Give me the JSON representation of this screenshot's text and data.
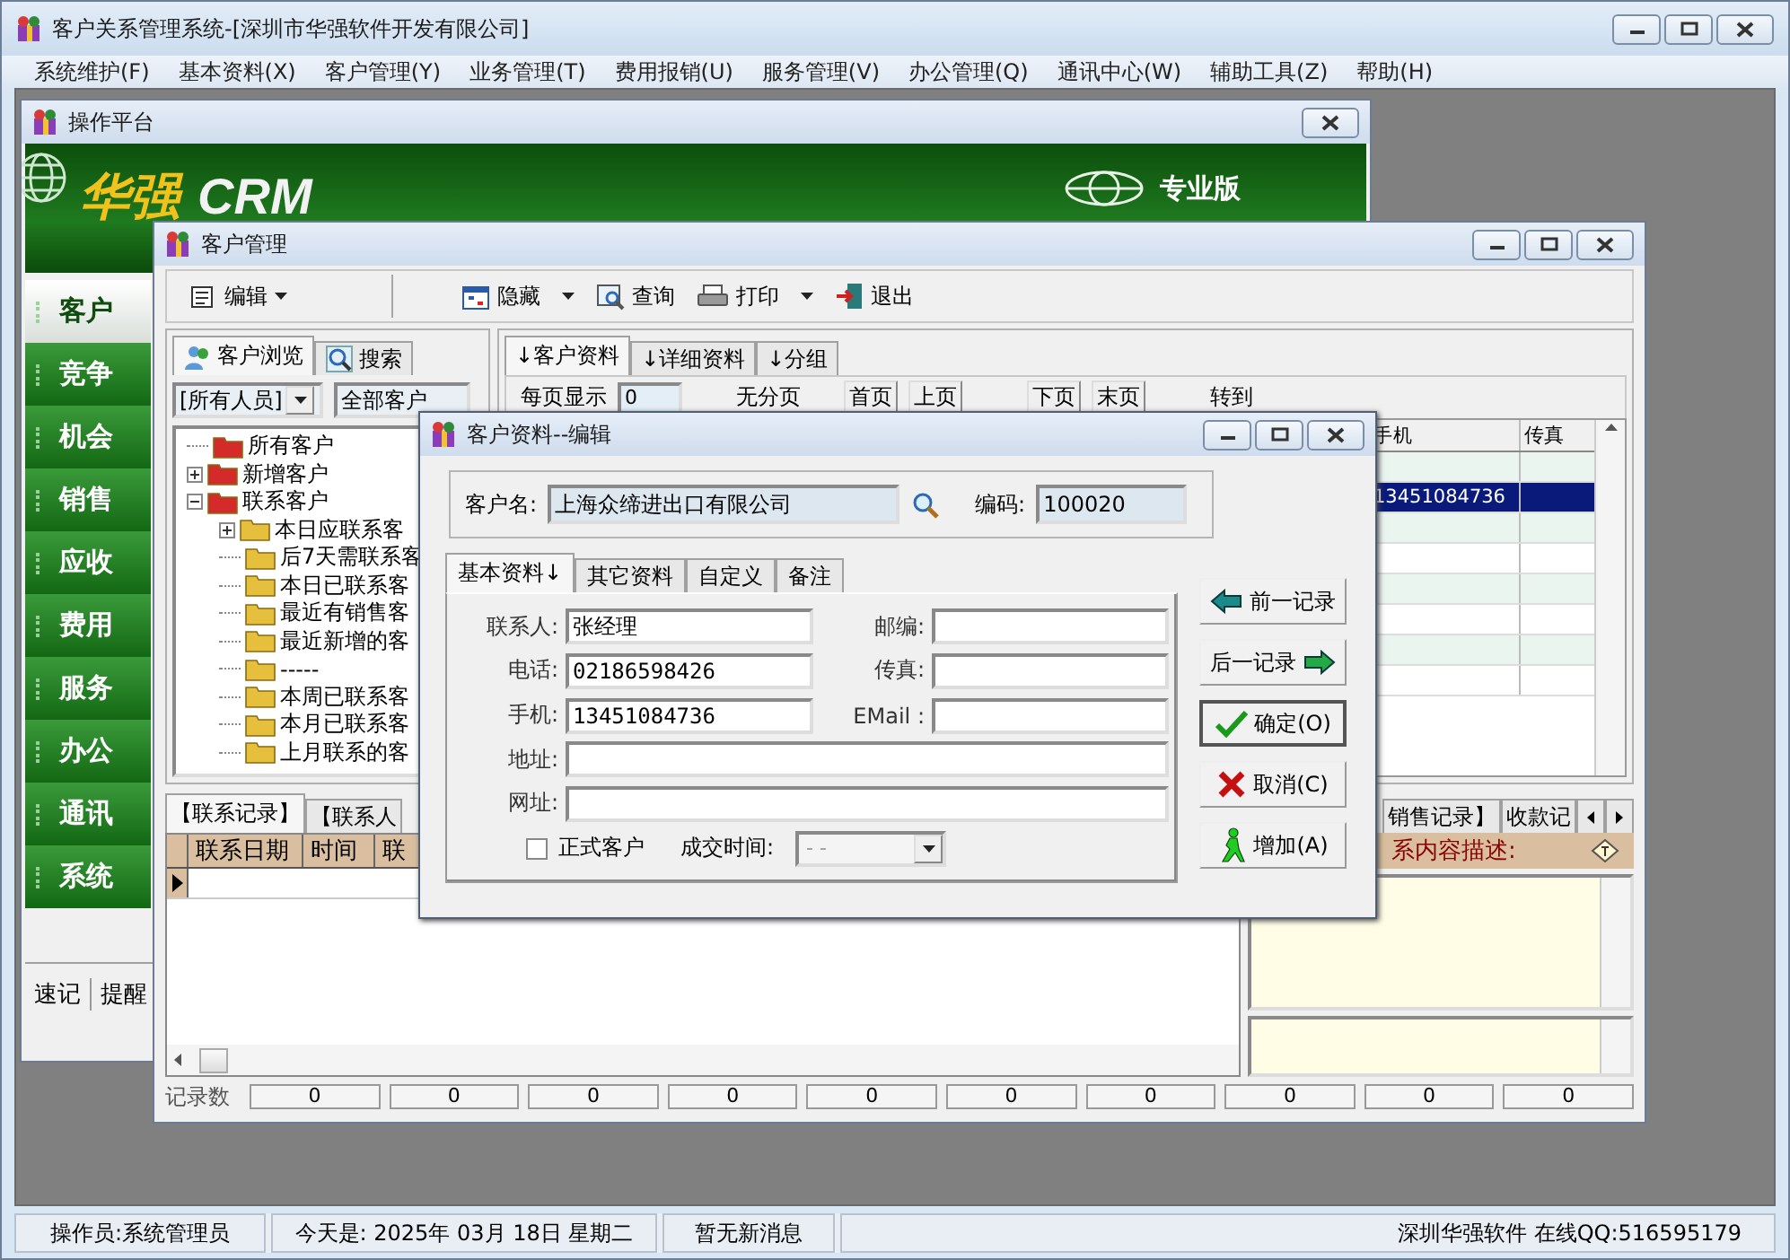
{
  "window": {
    "title": "客户关系管理系统-[深圳市华强软件开发有限公司]"
  },
  "menu": [
    "系统维护(F)",
    "基本资料(X)",
    "客户管理(Y)",
    "业务管理(T)",
    "费用报销(U)",
    "服务管理(V)",
    "办公管理(Q)",
    "通讯中心(W)",
    "辅助工具(Z)",
    "帮助(H)"
  ],
  "platform": {
    "title": "操作平台",
    "brand": "华强",
    "product": "CRM",
    "edition": "专业版",
    "nav": [
      {
        "label": "客户",
        "selected": true
      },
      {
        "label": "竞争",
        "selected": false
      },
      {
        "label": "机会",
        "selected": false
      },
      {
        "label": "销售",
        "selected": false
      },
      {
        "label": "应收",
        "selected": false
      },
      {
        "label": "费用",
        "selected": false
      },
      {
        "label": "服务",
        "selected": false
      },
      {
        "label": "办公",
        "selected": false
      },
      {
        "label": "通讯",
        "selected": false
      },
      {
        "label": "系统",
        "selected": false
      }
    ],
    "bottom_tabs": [
      "速记",
      "提醒"
    ]
  },
  "customer_manager": {
    "title": "客户管理",
    "toolbar": [
      {
        "kind": "menu",
        "label": "编辑"
      },
      {
        "kind": "hide",
        "label": "隐藏"
      },
      {
        "kind": "dropdown"
      },
      {
        "kind": "query",
        "label": "查询"
      },
      {
        "kind": "print",
        "label": "打印"
      },
      {
        "kind": "dropdown"
      },
      {
        "kind": "exit",
        "label": "退出"
      }
    ],
    "browse_tabs": [
      {
        "label": "客户浏览",
        "selected": true
      },
      {
        "label": "搜索",
        "selected": false
      }
    ],
    "staff_filter": "[所有人员]",
    "customer_filter": "全部客户",
    "tree": [
      {
        "label": "所有客户",
        "kind": "leaf",
        "color": "#d42a2a"
      },
      {
        "label": "新增客户",
        "kind": "branch",
        "expanded": false,
        "color": "#d42a2a"
      },
      {
        "label": "联系客户",
        "kind": "branch",
        "expanded": true,
        "color": "#d42a2a",
        "children": [
          {
            "label": "本日应联系客",
            "kind": "branch",
            "expanded": false,
            "color": "#e6bf3c"
          },
          {
            "label": "后7天需联系客",
            "kind": "leaf",
            "color": "#e6bf3c"
          },
          {
            "label": "本日已联系客",
            "kind": "leaf",
            "color": "#e6bf3c"
          },
          {
            "label": "最近有销售客",
            "kind": "leaf",
            "color": "#e6bf3c"
          },
          {
            "label": "最近新增的客",
            "kind": "leaf",
            "color": "#e6bf3c"
          },
          {
            "label": "-----",
            "kind": "leaf",
            "color": "#e6bf3c"
          },
          {
            "label": "本周已联系客",
            "kind": "leaf",
            "color": "#e6bf3c"
          },
          {
            "label": "本月已联系客",
            "kind": "leaf",
            "color": "#e6bf3c"
          },
          {
            "label": "上月联系的客",
            "kind": "leaf",
            "color": "#e6bf3c"
          }
        ]
      }
    ],
    "record_tabs": [
      {
        "label": "↓客户资料",
        "selected": true
      },
      {
        "label": "↓详细资料",
        "selected": false
      },
      {
        "label": "↓分组",
        "selected": false
      }
    ],
    "paging": {
      "page_size_label": "每页显示",
      "page_size": "0",
      "mode": "无分页",
      "first": "首页",
      "prev": "上页",
      "next": "下页",
      "last": "末页",
      "goto_label": "转到"
    },
    "table": {
      "columns": [
        "手机",
        "传真"
      ],
      "rows": [
        {
          "selected": false
        },
        {
          "mobile": "13451084736",
          "selected": true
        },
        {
          "selected": false
        },
        {
          "selected": false
        },
        {
          "selected": false
        },
        {
          "selected": false
        },
        {
          "selected": false
        },
        {
          "selected": false
        }
      ]
    },
    "detail_tabs": [
      {
        "label": "【联系记录】",
        "selected": true
      },
      {
        "label": "【联系人",
        "selected": false
      },
      {
        "label": "销售记录】",
        "selected": false
      },
      {
        "label": "收款记",
        "selected": false
      }
    ],
    "contact_grid": {
      "columns": [
        "联系日期",
        "时间",
        "联"
      ]
    },
    "description": {
      "label": "系内容描述:"
    },
    "counts": {
      "label": "记录数",
      "values": [
        "0",
        "0",
        "0",
        "0",
        "0",
        "0",
        "0",
        "0",
        "0",
        "0"
      ]
    }
  },
  "dialog": {
    "title": "客户资料--编辑",
    "name_label": "客户名:",
    "name": "上海众缔进出口有限公司",
    "code_label": "编码:",
    "code": "100020",
    "tabs": [
      {
        "label": "基本资料↓",
        "selected": true
      },
      {
        "label": "其它资料",
        "selected": false
      },
      {
        "label": "自定义",
        "selected": false
      },
      {
        "label": "备注",
        "selected": false
      }
    ],
    "fields": [
      {
        "label": "联系人:",
        "value": "张经理"
      },
      {
        "label": "邮编:"
      },
      {
        "label": "电话:",
        "value": "02186598426"
      },
      {
        "label": "传真:"
      },
      {
        "label": "手机:",
        "value": "13451084736"
      },
      {
        "label": "EMail :"
      },
      {
        "label": "地址:",
        "wide": true
      },
      {
        "label": "网址:",
        "wide": true
      }
    ],
    "formal": {
      "label": "正式客户",
      "checked": false
    },
    "deal_time": {
      "label": "成交时间:",
      "value": "- -",
      "disabled": true
    },
    "buttons": [
      {
        "kind": "prev",
        "label": "前一记录"
      },
      {
        "kind": "next",
        "label": "后一记录"
      },
      {
        "kind": "ok",
        "label": "确定(O)",
        "default": true
      },
      {
        "kind": "cancel",
        "label": "取消(C)",
        "default": false
      },
      {
        "kind": "add",
        "label": "增加(A)",
        "default": false
      }
    ]
  },
  "status_bar": {
    "operator": "操作员:系统管理员",
    "date": "今天是: 2025年 03月 18日  星期二",
    "message": "暂无新消息",
    "contact": "深圳华强软件 在线QQ:516595179"
  }
}
